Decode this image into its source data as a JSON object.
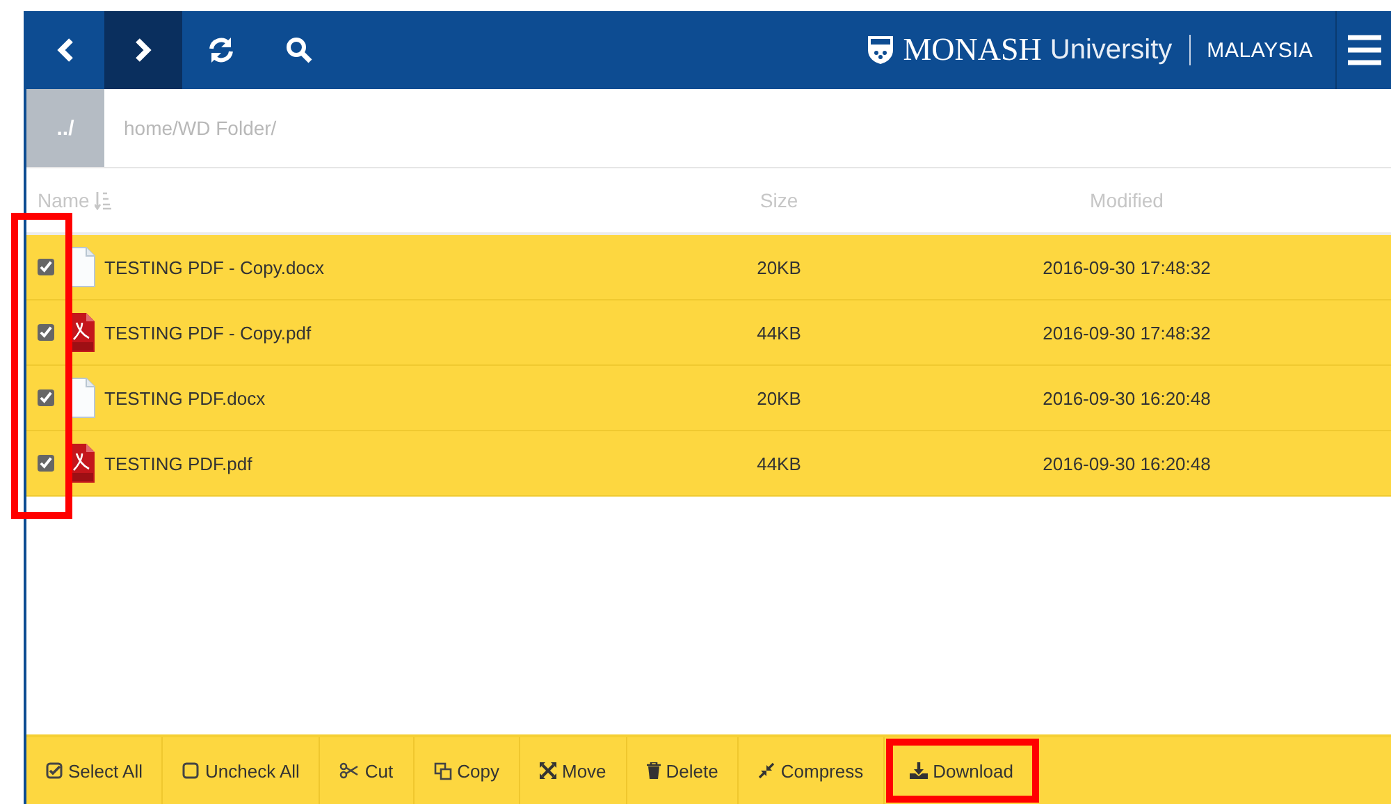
{
  "header": {
    "nav": [
      {
        "kind": "back",
        "selected": false
      },
      {
        "kind": "forward",
        "selected": true
      },
      {
        "kind": "refresh",
        "selected": false
      },
      {
        "kind": "search",
        "selected": false
      }
    ],
    "logo": {
      "name": "MONASH",
      "subname": "University",
      "campus": "MALAYSIA"
    }
  },
  "path": {
    "up": "../",
    "current": "home/WD Folder/"
  },
  "table": {
    "columns": [
      "Name",
      "Size",
      "Modified"
    ],
    "checkboxes_marked": true,
    "rows": [
      {
        "kind": "document",
        "name": "TESTING PDF - Copy.docx",
        "size": "20KB",
        "modified": "2016-09-30 17:48:32",
        "checked": true,
        "selected": true
      },
      {
        "kind": "pdf",
        "name": "TESTING PDF - Copy.pdf",
        "size": "44KB",
        "modified": "2016-09-30 17:48:32",
        "checked": true,
        "selected": true
      },
      {
        "kind": "document",
        "name": "TESTING PDF.docx",
        "size": "20KB",
        "modified": "2016-09-30 16:20:48",
        "checked": true,
        "selected": true
      },
      {
        "kind": "pdf",
        "name": "TESTING PDF.pdf",
        "size": "44KB",
        "modified": "2016-09-30 16:20:48",
        "checked": true,
        "selected": true
      }
    ]
  },
  "toolbar": [
    {
      "kind": "select-all",
      "label": "Select All",
      "marked": false
    },
    {
      "kind": "uncheck-all",
      "label": "Uncheck All",
      "marked": false
    },
    {
      "kind": "cut",
      "label": "Cut",
      "marked": false
    },
    {
      "kind": "copy",
      "label": "Copy",
      "marked": false
    },
    {
      "kind": "move",
      "label": "Move",
      "marked": false
    },
    {
      "kind": "delete",
      "label": "Delete",
      "marked": false
    },
    {
      "kind": "compress",
      "label": "Compress",
      "marked": false
    },
    {
      "kind": "download",
      "label": "Download",
      "marked": true
    }
  ]
}
